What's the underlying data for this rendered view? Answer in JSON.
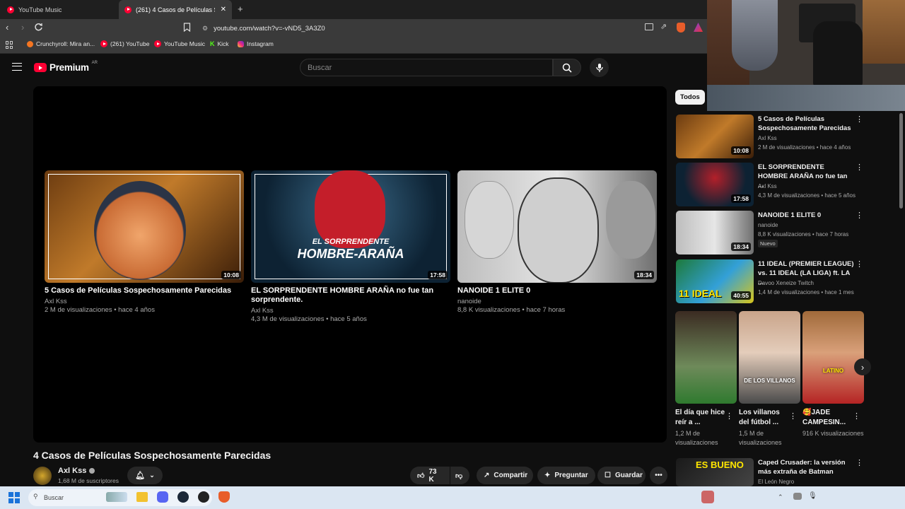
{
  "browser": {
    "tabs": [
      {
        "label": "YouTube Music",
        "active": false
      },
      {
        "label": "(261) 4 Casos de Películas Sospe",
        "active": true
      }
    ],
    "url": "youtube.com/watch?v=-vND5_3A3Z0",
    "bookmarks": [
      "Crunchyroll: Mira an...",
      "(261) YouTube",
      "YouTube Music",
      "Kick",
      "Instagram"
    ]
  },
  "header": {
    "logo": "Premium",
    "region": "AR",
    "search_placeholder": "Buscar"
  },
  "endscreen": [
    {
      "title": "5 Casos de Películas Sospechosamente Parecidas",
      "channel": "Axl Kss",
      "meta": "2 M de visualizaciones • hace 4 años",
      "duration": "10:08"
    },
    {
      "title": "EL SORPRENDENTE HOMBRE ARAÑA no fue tan sorprendente.",
      "channel": "Axl Kss",
      "meta": "4,3 M de visualizaciones • hace 5 años",
      "duration": "17:58",
      "overlay_top": "EL SORPRENDENTE",
      "overlay_bottom": "HOMBRE-ARAÑA"
    },
    {
      "title": "NANOIDE 1 ELITE 0",
      "channel": "nanoide",
      "meta": "8,8 K visualizaciones • hace 7 horas",
      "duration": "18:34"
    }
  ],
  "video": {
    "title": "4 Casos de Películas Sospechosamente Parecidas",
    "channel": "Axl Kss",
    "subscribers": "1,68 M de suscriptores",
    "likes": "73 K",
    "share": "Compartir",
    "ask": "Preguntar",
    "save": "Guardar"
  },
  "sidebar": {
    "chip": "Todos",
    "recs": [
      {
        "title": "5 Casos de Películas Sospechosamente Parecidas",
        "channel": "Axl Kss",
        "meta": "2 M de visualizaciones • hace 4 años",
        "duration": "10:08"
      },
      {
        "title": "EL SORPRENDENTE HOMBRE ARAÑA no fue tan ...",
        "channel": "Axl Kss",
        "meta": "4,3 M de visualizaciones • hace 5 años",
        "duration": "17:58"
      },
      {
        "title": "NANOIDE 1 ELITE 0",
        "channel": "nanoide",
        "meta": "8,8 K visualizaciones • hace 7 horas",
        "duration": "18:34",
        "badge": "Nuevo"
      },
      {
        "title": "11 IDEAL (PREMIER LEAGUE) vs. 11 IDEAL (LA LIGA) ft. LA ...",
        "channel": "Davoo Xeneize Twitch",
        "meta": "1,4 M de visualizaciones • hace 1 mes",
        "duration": "40:55",
        "overlay": "11 IDEAL"
      }
    ],
    "shorts": [
      {
        "title": "El día que hice reír a ...",
        "meta": "1,2 M de visualizaciones"
      },
      {
        "title": "Los villanos del fútbol ...",
        "meta": "1,5 M de visualizaciones",
        "overlay": "DE LOS VILLANOS"
      },
      {
        "title": "🥰JADE CAMPESIN...",
        "meta": "916 K visualizaciones",
        "overlay": "LATINO"
      }
    ],
    "last_rec": {
      "title": "Caped Crusader: la versión más extraña de Batman",
      "channel": "El León Negro",
      "overlay": "ES BUENO"
    }
  },
  "taskbar": {
    "search": "Buscar"
  },
  "colors": {
    "yt_red": "#ff0033",
    "bg": "#0f0f0f",
    "chip": "#272727"
  }
}
